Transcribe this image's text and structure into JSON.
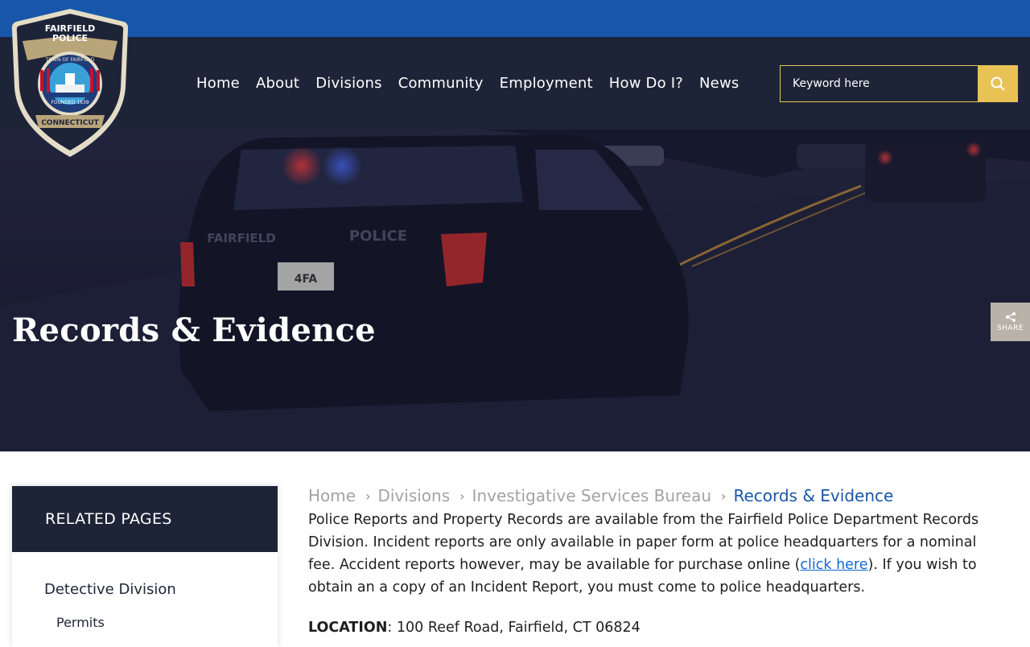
{
  "logo": {
    "line1": "FAIRFIELD",
    "line2": "POLICE",
    "ring": "TOWN OF FAIRFIELD",
    "founded": "FOUNDED 1639",
    "state": "CONNECTICUT"
  },
  "nav": {
    "items": [
      "Home",
      "About",
      "Divisions",
      "Community",
      "Employment",
      "How Do I?",
      "News"
    ]
  },
  "search": {
    "placeholder": "Keyword here",
    "icon": "search-icon"
  },
  "hero": {
    "title": "Records & Evidence",
    "car_text": "POLICE",
    "car_text2": "FAIRFIELD",
    "plate": "4FA"
  },
  "share": {
    "label": "SHARE",
    "icon": "share-icon"
  },
  "related": {
    "heading": "RELATED PAGES",
    "item": "Detective Division",
    "subitem": "Permits"
  },
  "breadcrumb": {
    "items": [
      "Home",
      "Divisions",
      "Investigative Services Bureau",
      "Records & Evidence"
    ]
  },
  "content": {
    "para_part1": "Police Reports and Property Records are available from the Fairfield Police Department Records Division.  Incident reports are only available in paper form at police headquarters for a nominal fee.  Accident reports however, may be available for purchase online (",
    "link_text": "click here",
    "para_part2": ").  If you wish to obtain an a copy of an Incident Report, you must come to police headquarters.",
    "location_label": "LOCATION",
    "location_value": ": 100 Reef Road, Fairfield, CT 06824"
  },
  "colors": {
    "topbar": "#1756a9",
    "navbar": "#1e2438",
    "accent": "#e9c255",
    "link": "#1466d6"
  }
}
